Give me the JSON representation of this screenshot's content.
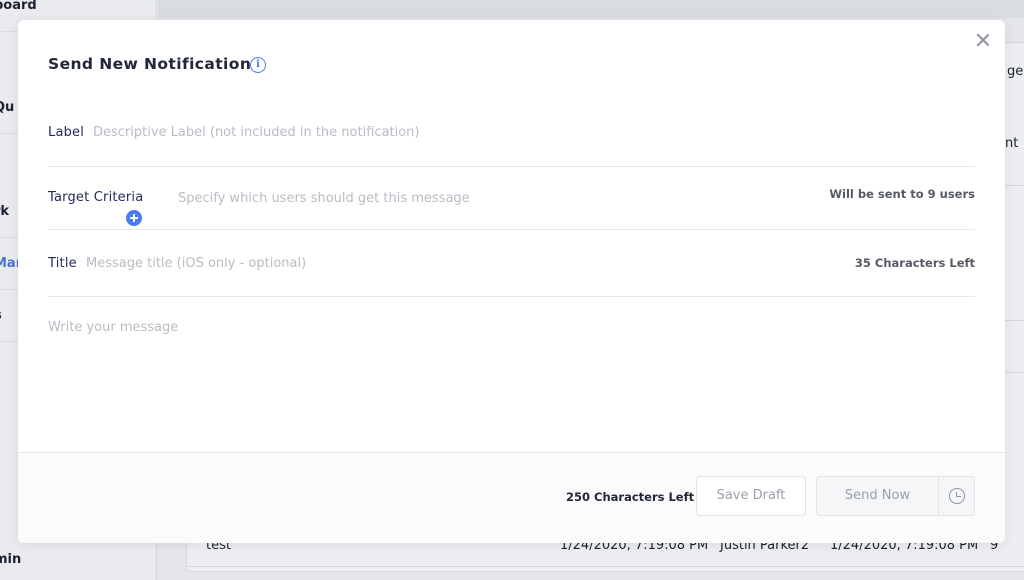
{
  "background": {
    "sidebar_items": [
      "board",
      "Qu",
      "rk",
      "Mar",
      "s",
      "min"
    ],
    "fragments": [
      "ge",
      "nt"
    ],
    "row": {
      "name": "test",
      "created": "1/24/2020, 7:19:08 PM",
      "author": "Justin Parker2",
      "updated": "1/24/2020, 7:19:08 PM",
      "count": "9"
    }
  },
  "modal": {
    "title": "Send New Notification",
    "info_icon": "info-icon",
    "close_icon": "close-icon",
    "label": {
      "label": "Label",
      "placeholder": "Descriptive Label (not included in the notification)",
      "value": ""
    },
    "target": {
      "label": "Target Criteria",
      "placeholder": "Specify which users should get this message",
      "info": "Will be sent to 9 users",
      "add_icon": "plus-circle-icon"
    },
    "title_field": {
      "label": "Title",
      "placeholder": "Message title (iOS only - optional)",
      "counter": "35 Characters Left",
      "value": ""
    },
    "message": {
      "placeholder": "Write your message",
      "value": ""
    },
    "footer": {
      "chars_left": "250 Characters Left",
      "save_draft": "Save Draft",
      "send_now": "Send Now",
      "schedule_icon": "clock-icon"
    }
  },
  "colors": {
    "accent": "#4a7cf0",
    "label_text": "#1e2a5a",
    "placeholder": "#b9bcc5",
    "overlay_bg": "#e6e8ec"
  }
}
